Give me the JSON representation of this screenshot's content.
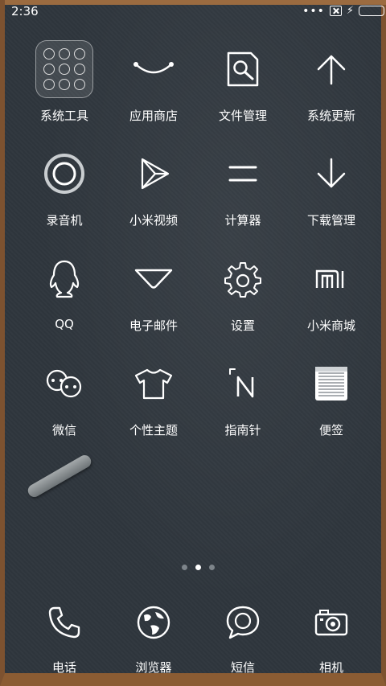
{
  "status_bar": {
    "time": "2:36",
    "dots": "•••",
    "sim_icon": "sim-absent-icon",
    "charging_icon": "⚡",
    "battery_color": "#34c759"
  },
  "apps": [
    {
      "label": "系统工具",
      "icon": "folder-icon"
    },
    {
      "label": "应用商店",
      "icon": "smile-arc-icon"
    },
    {
      "label": "文件管理",
      "icon": "file-search-icon"
    },
    {
      "label": "系统更新",
      "icon": "arrow-up-icon"
    },
    {
      "label": "录音机",
      "icon": "record-circle-icon"
    },
    {
      "label": "小米视频",
      "icon": "play-triangle-icon"
    },
    {
      "label": "计算器",
      "icon": "equals-icon"
    },
    {
      "label": "下载管理",
      "icon": "arrow-down-icon"
    },
    {
      "label": "QQ",
      "icon": "penguin-icon"
    },
    {
      "label": "电子邮件",
      "icon": "envelope-icon"
    },
    {
      "label": "设置",
      "icon": "gear-icon"
    },
    {
      "label": "小米商城",
      "icon": "mi-logo-icon"
    },
    {
      "label": "微信",
      "icon": "wechat-icon"
    },
    {
      "label": "个性主题",
      "icon": "tshirt-icon"
    },
    {
      "label": "指南针",
      "icon": "compass-n-icon"
    },
    {
      "label": "便签",
      "icon": "notepad-icon"
    }
  ],
  "pager": {
    "count": 3,
    "active": 2
  },
  "dock": [
    {
      "label": "电话",
      "icon": "phone-icon"
    },
    {
      "label": "浏览器",
      "icon": "globe-icon"
    },
    {
      "label": "短信",
      "icon": "chat-bubble-icon"
    },
    {
      "label": "相机",
      "icon": "camera-icon"
    }
  ],
  "colors": {
    "wallpaper": "#2f363d",
    "frame_wood": "#8b5c33",
    "foreground": "#ffffff"
  }
}
